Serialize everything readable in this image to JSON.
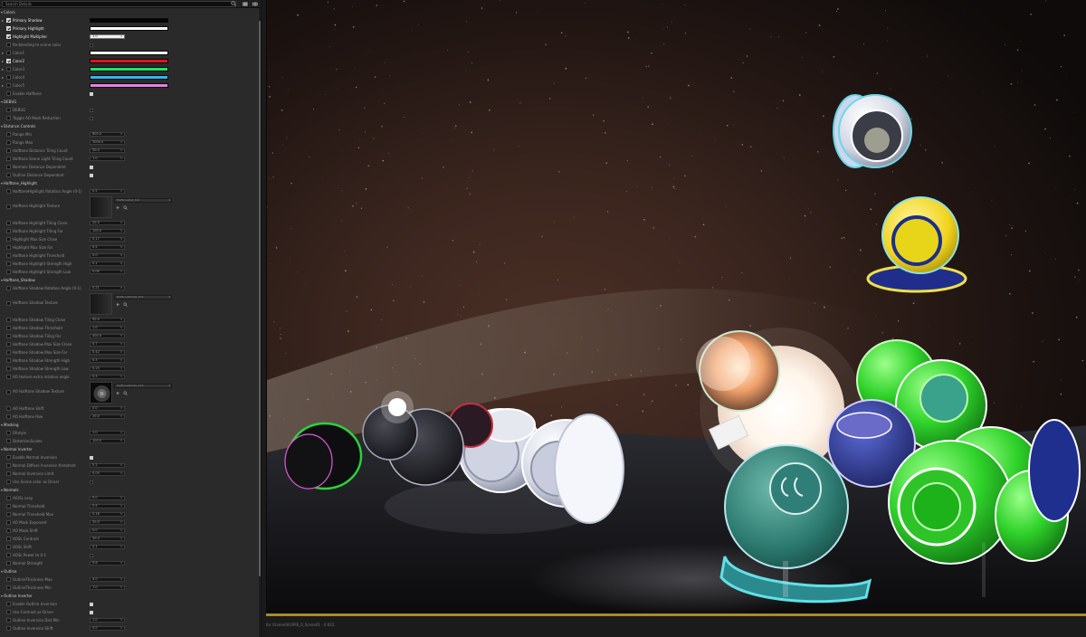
{
  "search": {
    "placeholder": "Search Details"
  },
  "status": {
    "text": "for /Game/UEOPIE_0_Scene01 - 0.622"
  },
  "colors": {
    "accent": "#a88a2a",
    "panel": "#2a2a2a"
  },
  "rows": [
    {
      "kind": "cat",
      "label": "Colors"
    },
    {
      "kind": "prop",
      "label": "Primary Shadow",
      "checked": true,
      "expand": true,
      "widget": "bar",
      "color": "#050505"
    },
    {
      "kind": "prop",
      "label": "Primary Highlight",
      "checked": true,
      "widget": "bar",
      "color": "#ffffff"
    },
    {
      "kind": "prop",
      "label": "Highlight Multiplier",
      "checked": true,
      "widget": "value",
      "value": "1.0",
      "light": true
    },
    {
      "kind": "prop",
      "label": "Re-blending to scene color",
      "checked": false,
      "widget": "mini",
      "on": false
    },
    {
      "kind": "prop",
      "label": "Color1",
      "checked": false,
      "expand": true,
      "widget": "bar",
      "color": "#ffffff"
    },
    {
      "kind": "prop",
      "label": "Color2",
      "checked": true,
      "expand": true,
      "widget": "bar",
      "color": "#e0141e"
    },
    {
      "kind": "prop",
      "label": "Color3",
      "checked": false,
      "expand": true,
      "widget": "bar",
      "color": "#14e86a"
    },
    {
      "kind": "prop",
      "label": "Color4",
      "checked": false,
      "expand": true,
      "widget": "bar",
      "color": "#2ab8f0"
    },
    {
      "kind": "prop",
      "label": "Color5",
      "checked": false,
      "expand": true,
      "widget": "bar",
      "color": "#e880e0"
    },
    {
      "kind": "prop",
      "label": "Enable Halftone",
      "checked": false,
      "widget": "mini",
      "on": true
    },
    {
      "kind": "cat",
      "label": "DEBUG"
    },
    {
      "kind": "prop",
      "label": "DEBUG",
      "checked": false,
      "widget": "mini",
      "on": false
    },
    {
      "kind": "prop",
      "label": "Toggle AO Mask Reduction",
      "checked": false,
      "widget": "mini",
      "on": false
    },
    {
      "kind": "cat",
      "label": "Distance Controls"
    },
    {
      "kind": "prop",
      "label": "Range Min",
      "checked": false,
      "widget": "value",
      "value": "600.0"
    },
    {
      "kind": "prop",
      "label": "Range Max",
      "checked": false,
      "widget": "value",
      "value": "3000.0"
    },
    {
      "kind": "prop",
      "label": "Halftone Distance Tiling Count",
      "checked": false,
      "widget": "value",
      "value": "50.0"
    },
    {
      "kind": "prop",
      "label": "Halftone Scene Light Tiling Count",
      "checked": false,
      "widget": "value",
      "value": "1.0"
    },
    {
      "kind": "prop",
      "label": "Normals Distance Dependent",
      "checked": false,
      "widget": "mini",
      "on": true
    },
    {
      "kind": "prop",
      "label": "Outline Distance Dependent",
      "checked": false,
      "widget": "mini",
      "on": true
    },
    {
      "kind": "cat",
      "label": "Halftone_Highlight"
    },
    {
      "kind": "prop",
      "label": "HalftoneHighlight Rotation Angle (0-1)",
      "checked": false,
      "widget": "value",
      "value": "0.5"
    },
    {
      "kind": "tex",
      "label": "Halftone Highlight Texture",
      "asset": "HalftoneDot_512"
    },
    {
      "kind": "prop",
      "label": "Halftone Highlight Tiling Close",
      "checked": false,
      "widget": "value",
      "value": "20.0"
    },
    {
      "kind": "prop",
      "label": "Halftone Highlight Tiling Far",
      "checked": false,
      "widget": "value",
      "value": "100.0"
    },
    {
      "kind": "prop",
      "label": "Highlight Max Size Close",
      "checked": false,
      "widget": "value",
      "value": "0.17"
    },
    {
      "kind": "prop",
      "label": "Highlight Max Size Far",
      "checked": false,
      "widget": "value",
      "value": "0.5"
    },
    {
      "kind": "prop",
      "label": "Halftone Highlight Threshold",
      "checked": false,
      "widget": "value",
      "value": "0.0"
    },
    {
      "kind": "prop",
      "label": "Halftone Highlight Strength High",
      "checked": false,
      "widget": "value",
      "value": "0.1"
    },
    {
      "kind": "prop",
      "label": "Halftone Highlight Strength Low",
      "checked": false,
      "widget": "value",
      "value": "0.05"
    },
    {
      "kind": "cat",
      "label": "Halftone_Shadow"
    },
    {
      "kind": "prop",
      "label": "Halftone Shadow Rotation Angle (0-1)",
      "checked": false,
      "widget": "value",
      "value": "0.21"
    },
    {
      "kind": "tex",
      "label": "Halftone Shadow Texture",
      "asset": "HalftoneStroke_512"
    },
    {
      "kind": "prop",
      "label": "Halftone Shadow Tiling Close",
      "checked": false,
      "widget": "value",
      "value": "50.0"
    },
    {
      "kind": "prop",
      "label": "Halftone Shadow Threshold",
      "checked": false,
      "widget": "value",
      "value": "1.0"
    },
    {
      "kind": "prop",
      "label": "Halftone Shadow Tiling Far",
      "checked": false,
      "widget": "value",
      "value": "400.0"
    },
    {
      "kind": "prop",
      "label": "Halftone Shadow Max Size Close",
      "checked": false,
      "widget": "value",
      "value": "0.7"
    },
    {
      "kind": "prop",
      "label": "Halftone Shadow Max Size Far",
      "checked": false,
      "widget": "value",
      "value": "0.42"
    },
    {
      "kind": "prop",
      "label": "Halftone Shadow Strength High",
      "checked": false,
      "widget": "value",
      "value": "0.3"
    },
    {
      "kind": "prop",
      "label": "Halftone Shadow Strength Low",
      "checked": false,
      "widget": "value",
      "value": "0.25"
    },
    {
      "kind": "prop",
      "label": "AO texture extra rotation angle",
      "checked": false,
      "widget": "value",
      "value": "0.3"
    },
    {
      "kind": "tex",
      "label": "AO Halftone Shadow Texture",
      "asset": "HalftoneStroke_512"
    },
    {
      "kind": "prop",
      "label": "AO Halftone Shift",
      "checked": false,
      "widget": "value",
      "value": "0.0"
    },
    {
      "kind": "prop",
      "label": "AO Halftone Pow",
      "checked": false,
      "widget": "value",
      "value": "20.0"
    },
    {
      "kind": "cat",
      "label": "Masking"
    },
    {
      "kind": "prop",
      "label": "Fillstyle",
      "checked": false,
      "widget": "value",
      "value": "1.0"
    },
    {
      "kind": "prop",
      "label": "DistortionScales",
      "checked": false,
      "widget": "value",
      "value": "100.0"
    },
    {
      "kind": "cat",
      "label": "Normal Inverter"
    },
    {
      "kind": "prop",
      "label": "Enable Normal Inversion",
      "checked": false,
      "widget": "mini",
      "on": true
    },
    {
      "kind": "prop",
      "label": "Normal Diffuse Inversion threshold",
      "checked": false,
      "widget": "value",
      "value": "0.2"
    },
    {
      "kind": "prop",
      "label": "Normal Inversion Limit",
      "checked": false,
      "widget": "value",
      "value": "0.05"
    },
    {
      "kind": "prop",
      "label": "Use Scene color as Driver",
      "checked": false,
      "widget": "mini",
      "on": false
    },
    {
      "kind": "cat",
      "label": "Normals"
    },
    {
      "kind": "prop",
      "label": "AO/SL Lerp",
      "checked": false,
      "widget": "value",
      "value": "0.0"
    },
    {
      "kind": "prop",
      "label": "Normal Threshold",
      "checked": false,
      "widget": "value",
      "value": "0.5"
    },
    {
      "kind": "prop",
      "label": "Normal Threshold Max",
      "checked": false,
      "widget": "value",
      "value": "0.16"
    },
    {
      "kind": "prop",
      "label": "AO Mask Exponent",
      "checked": false,
      "widget": "value",
      "value": "20.0"
    },
    {
      "kind": "prop",
      "label": "AO Mask Shift",
      "checked": false,
      "widget": "value",
      "value": "0.0"
    },
    {
      "kind": "prop",
      "label": "AOSL Contrast",
      "checked": false,
      "widget": "value",
      "value": "30.0"
    },
    {
      "kind": "prop",
      "label": "AOSL Shift",
      "checked": false,
      "widget": "value",
      "value": "0.1"
    },
    {
      "kind": "prop",
      "label": "AOSL Power to 0-1",
      "checked": false,
      "widget": "mini",
      "on": false
    },
    {
      "kind": "prop",
      "label": "Normal Strength",
      "checked": false,
      "widget": "value",
      "value": "0.6"
    },
    {
      "kind": "cat",
      "label": "Outline"
    },
    {
      "kind": "prop",
      "label": "OutlineThickness Max",
      "checked": false,
      "widget": "value",
      "value": "4.0"
    },
    {
      "kind": "prop",
      "label": "OutlineThickness Min",
      "checked": false,
      "widget": "value",
      "value": "1.0"
    },
    {
      "kind": "cat",
      "label": "Outline Inverter"
    },
    {
      "kind": "prop",
      "label": "Enable Outline Inversion",
      "checked": false,
      "widget": "mini",
      "on": true
    },
    {
      "kind": "prop",
      "label": "Use Contrast as Driver",
      "checked": false,
      "widget": "mini",
      "on": true
    },
    {
      "kind": "prop",
      "label": "Outline Inversion Dist Min",
      "checked": false,
      "widget": "value",
      "value": "1.0"
    },
    {
      "kind": "prop",
      "label": "Outline Inversion Shift",
      "checked": false,
      "widget": "value",
      "value": "0.0"
    }
  ]
}
